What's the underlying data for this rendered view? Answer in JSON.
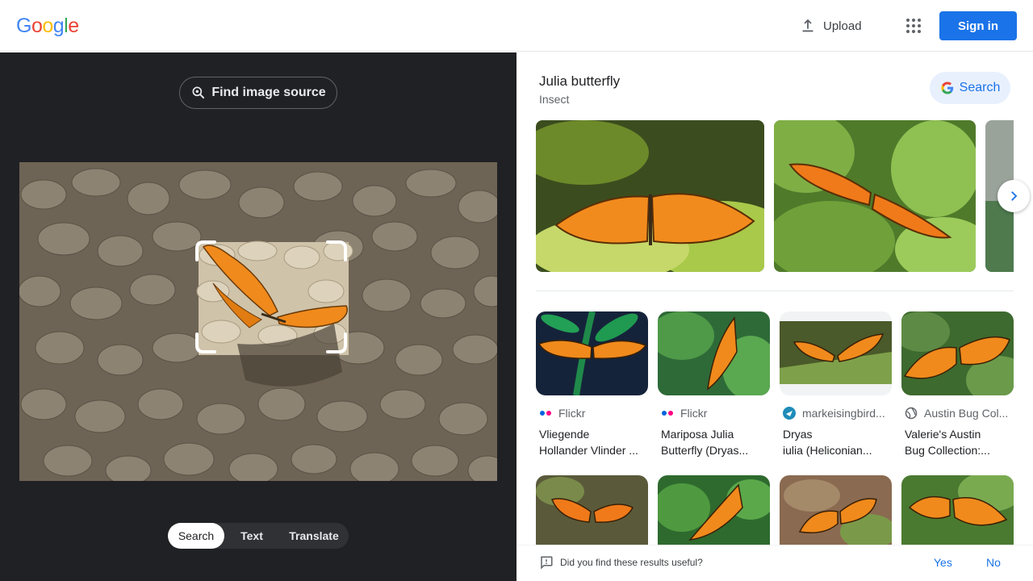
{
  "header": {
    "logo": "Google",
    "upload_label": "Upload",
    "sign_in_label": "Sign in"
  },
  "lens": {
    "find_source_label": "Find image source",
    "tabs": [
      {
        "label": "Search",
        "active": true
      },
      {
        "label": "Text",
        "active": false
      },
      {
        "label": "Translate",
        "active": false
      }
    ]
  },
  "knowledge": {
    "title": "Julia butterfly",
    "subtitle": "Insect",
    "search_label": "Search"
  },
  "results": [
    {
      "source": "Flickr",
      "title_line1": "Vliegende",
      "title_line2": "Hollander Vlinder ...",
      "icon": "flickr-icon"
    },
    {
      "source": "Flickr",
      "title_line1": "Mariposa Julia",
      "title_line2": "Butterfly (Dryas...",
      "icon": "flickr-icon"
    },
    {
      "source": "markeisingbird...",
      "title_line1": "Dryas",
      "title_line2": "iulia (Heliconian...",
      "icon": "bird-icon"
    },
    {
      "source": "Austin Bug Col...",
      "title_line1": "Valerie's Austin",
      "title_line2": "Bug Collection:...",
      "icon": "globe-icon"
    }
  ],
  "feedback": {
    "question": "Did you find these results useful?",
    "yes": "Yes",
    "no": "No"
  },
  "colors": {
    "accent": "#1a73e8",
    "dark_panel": "#202124",
    "butterfly_orange": "#f08a1c"
  }
}
